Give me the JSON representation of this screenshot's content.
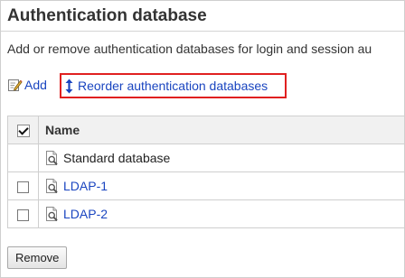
{
  "page": {
    "title": "Authentication database",
    "description": "Add or remove authentication databases for login and session au"
  },
  "toolbar": {
    "add_label": "Add",
    "add_icon": "edit-note-icon",
    "reorder_label": "Reorder authentication databases",
    "reorder_icon": "up-down-arrow-icon",
    "highlight_color": "#e02020"
  },
  "table": {
    "header_name": "Name",
    "rows": [
      {
        "name": "Standard database",
        "has_checkbox": false,
        "is_link": false
      },
      {
        "name": "LDAP-1",
        "has_checkbox": true,
        "is_link": true
      },
      {
        "name": "LDAP-2",
        "has_checkbox": true,
        "is_link": true
      }
    ]
  },
  "buttons": {
    "remove_label": "Remove"
  },
  "colors": {
    "link": "#1a45c0",
    "header_bg": "#f1f1f1",
    "border": "#cfcfcf"
  }
}
